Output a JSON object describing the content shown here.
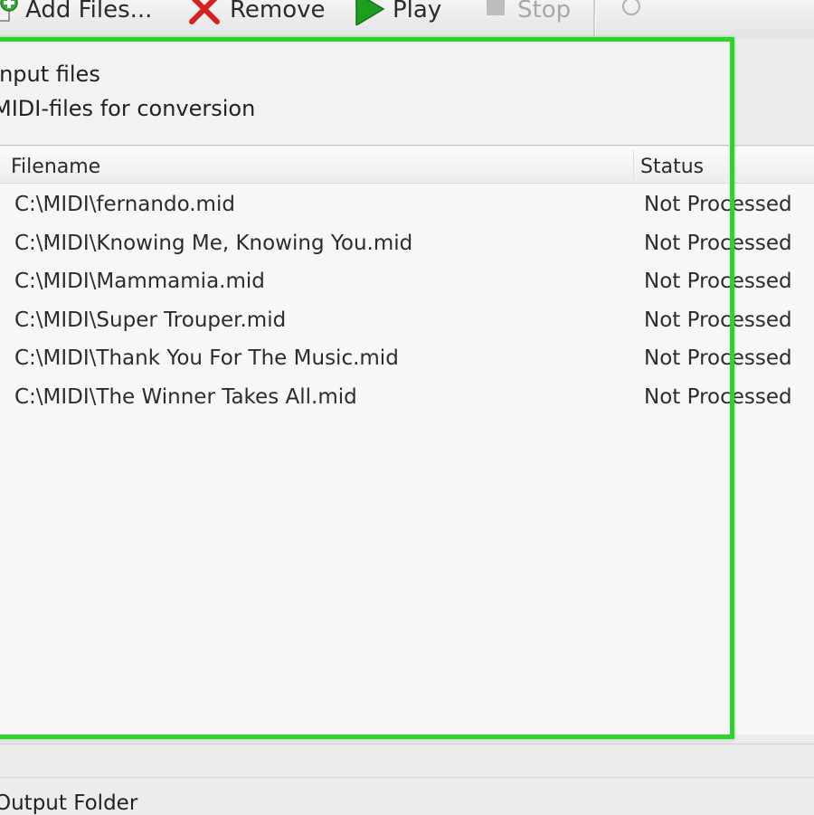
{
  "toolbar": {
    "add_files_label": "Add Files...",
    "remove_label": "Remove",
    "play_label": "Play",
    "stop_label": "Stop",
    "icons": {
      "add": "add-files-icon",
      "remove": "remove-icon",
      "play": "play-icon",
      "stop": "stop-icon",
      "help": "help-icon"
    }
  },
  "input_group": {
    "title": "Input files",
    "subtitle": "MIDI-files for conversion"
  },
  "file_list": {
    "columns": {
      "filename": "Filename",
      "status": "Status"
    },
    "rows": [
      {
        "filename": "C:\\MIDI\\fernando.mid",
        "status": "Not Processed"
      },
      {
        "filename": "C:\\MIDI\\Knowing Me, Knowing You.mid",
        "status": "Not Processed"
      },
      {
        "filename": "C:\\MIDI\\Mammamia.mid",
        "status": "Not Processed"
      },
      {
        "filename": "C:\\MIDI\\Super Trouper.mid",
        "status": "Not Processed"
      },
      {
        "filename": "C:\\MIDI\\Thank You For The Music.mid",
        "status": "Not Processed"
      },
      {
        "filename": "C:\\MIDI\\The Winner Takes All.mid",
        "status": "Not Processed"
      }
    ]
  },
  "output_group": {
    "title": "Output Folder"
  },
  "colors": {
    "highlight": "#2fd32f",
    "play_green": "#1e9e1e",
    "remove_red": "#d42020",
    "add_green": "#3aa83a"
  }
}
